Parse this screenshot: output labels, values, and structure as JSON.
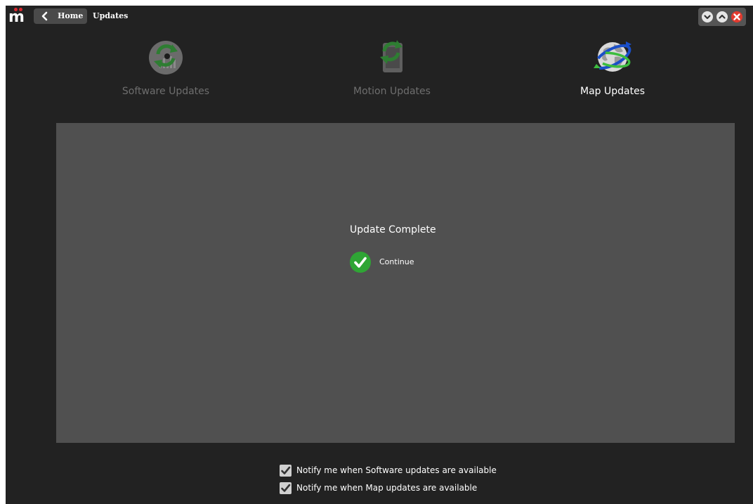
{
  "app": {
    "logo_text": "m",
    "brand_color": "#d9282f"
  },
  "header": {
    "back_label": "Home",
    "title": "Updates"
  },
  "window_controls": {
    "minimize_icon": "chevron-down-icon",
    "maximize_icon": "chevron-up-icon",
    "close_icon": "close-icon",
    "close_color": "#e23a2e"
  },
  "tabs": [
    {
      "label": "Software Updates",
      "icon": "software-update-icon",
      "active": false
    },
    {
      "label": "Motion Updates",
      "icon": "motion-update-icon",
      "active": false
    },
    {
      "label": "Map Updates",
      "icon": "map-globe-icon",
      "active": true
    }
  ],
  "status": {
    "title": "Update Complete",
    "continue_label": "Continue",
    "continue_icon": "checkmark-icon",
    "success_color": "#2fa535"
  },
  "notifications": [
    {
      "label": "Notify me when Software updates are available",
      "checked": true
    },
    {
      "label": "Notify me when Map updates are available",
      "checked": true
    }
  ]
}
